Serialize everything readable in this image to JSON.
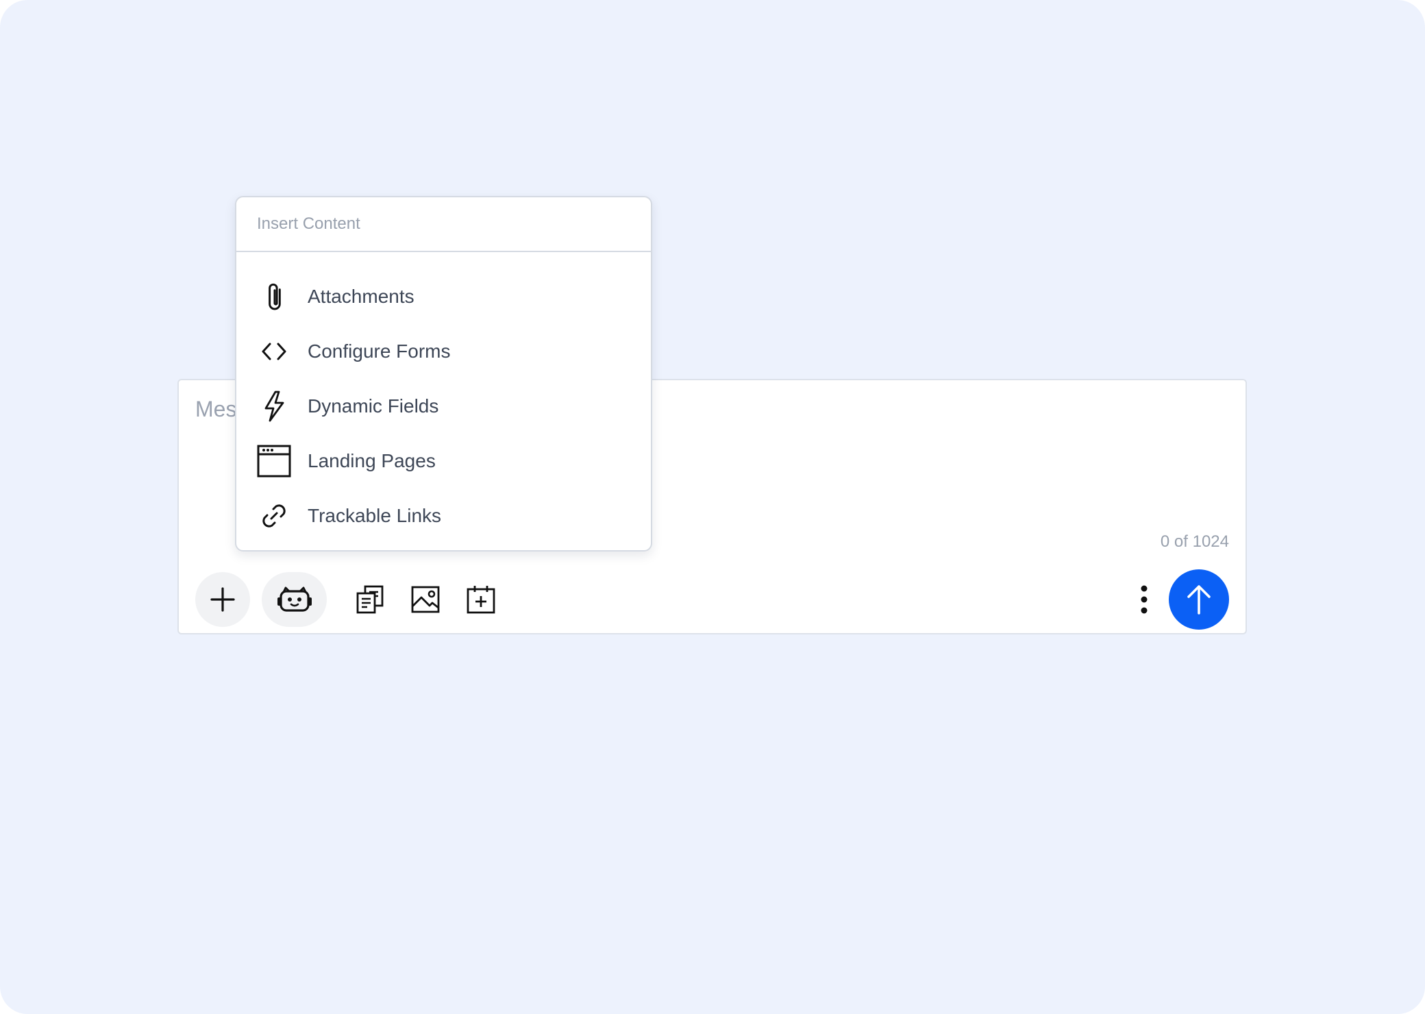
{
  "composer": {
    "placeholder": "Message",
    "char_count": "0 of 1024"
  },
  "menu": {
    "header": "Insert Content",
    "items": [
      {
        "label": "Attachments",
        "icon": "paperclip-icon"
      },
      {
        "label": "Configure Forms",
        "icon": "code-brackets-icon"
      },
      {
        "label": "Dynamic Fields",
        "icon": "lightning-icon"
      },
      {
        "label": "Landing Pages",
        "icon": "browser-window-icon"
      },
      {
        "label": "Trackable Links",
        "icon": "link-icon"
      }
    ]
  },
  "toolbar": {
    "icons": [
      "plus-icon",
      "bot-icon",
      "templates-icon",
      "image-icon",
      "calendar-add-icon",
      "more-vertical-icon",
      "arrow-up-icon"
    ]
  },
  "colors": {
    "background": "#edf2fd",
    "accent": "#0b60f5",
    "muted_text": "#98a0ad",
    "item_text": "#3d4656"
  }
}
